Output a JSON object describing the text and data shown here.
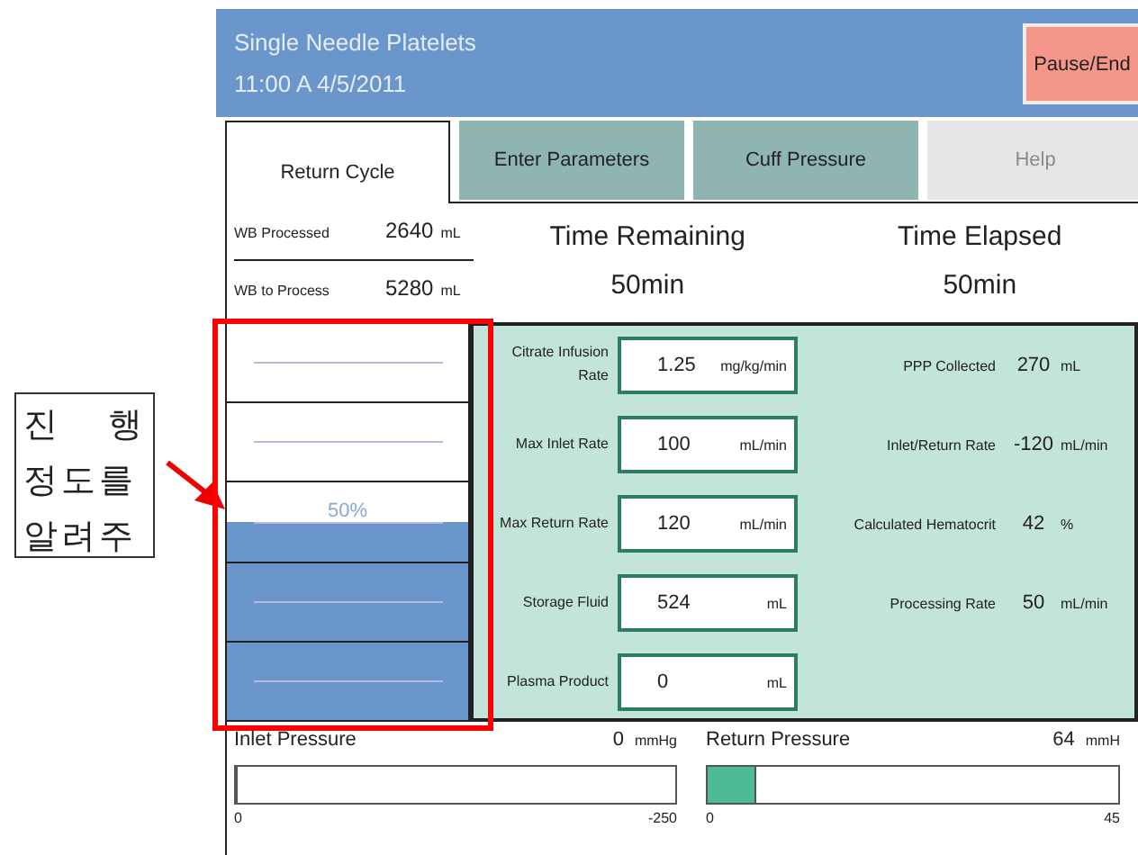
{
  "annotation": {
    "lines": [
      "진 행",
      "정도를",
      "알려주"
    ]
  },
  "header": {
    "title": "Single Needle Platelets",
    "datetime": "11:00 A  4/5/2011",
    "button": "Pause/End"
  },
  "tabs": [
    {
      "label": "Return Cycle",
      "selected": true,
      "disabled": false
    },
    {
      "label": "Enter Parameters",
      "selected": false,
      "disabled": false
    },
    {
      "label": "Cuff Pressure",
      "selected": false,
      "disabled": false
    },
    {
      "label": "Help",
      "selected": false,
      "disabled": true
    }
  ],
  "volumes": [
    {
      "label": "WB Processed",
      "value": "2640",
      "unit": "mL"
    },
    {
      "label": "WB to Process",
      "value": "5280",
      "unit": "mL"
    }
  ],
  "timers": [
    {
      "label": "Time Remaining",
      "value": "50min"
    },
    {
      "label": "Time Elapsed",
      "value": "50min"
    }
  ],
  "progress": {
    "level": 0.5,
    "reading": "50%"
  },
  "parameters": [
    {
      "label": "Citrate Infusion Rate",
      "value": "1.25",
      "unit": "mg/kg/min"
    },
    {
      "label": "Max Inlet Rate",
      "value": "100",
      "unit": "mL/min"
    },
    {
      "label": "Max Return Rate",
      "value": "120",
      "unit": "mL/min"
    },
    {
      "label": "Storage Fluid",
      "value": "524",
      "unit": "mL"
    },
    {
      "label": "Plasma Product",
      "value": "0",
      "unit": "mL"
    }
  ],
  "readouts": [
    {
      "label": "PPP Collected",
      "value": "270",
      "unit": "mL"
    },
    {
      "label": "Inlet/Return Rate",
      "value": "-120",
      "unit": "mL/min"
    },
    {
      "label": "Calculated Hematocrit",
      "value": "42",
      "unit": "%"
    },
    {
      "label": "Processing Rate",
      "value": "50",
      "unit": "mL/min"
    }
  ],
  "pressures": [
    {
      "label": "Inlet Pressure",
      "value": "0",
      "unit": "mmHg",
      "level": 0.005,
      "min": "0",
      "max": "-250"
    },
    {
      "label": "Return Pressure",
      "value": "64",
      "unit": "mmH",
      "level": 0.12,
      "min": "0",
      "max": "45"
    }
  ]
}
